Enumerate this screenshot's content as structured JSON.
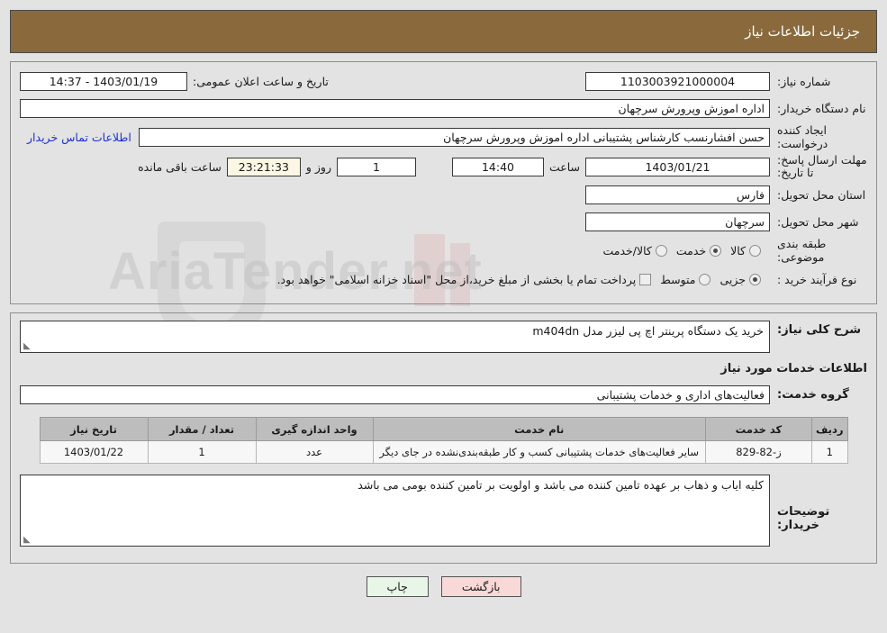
{
  "header": {
    "title": "جزئیات اطلاعات نیاز"
  },
  "form": {
    "need_number_label": "شماره نیاز:",
    "need_number": "1103003921000004",
    "announce_label": "تاریخ و ساعت اعلان عمومی:",
    "announce_value": "1403/01/19 - 14:37",
    "buyer_org_label": "نام دستگاه خریدار:",
    "buyer_org": "اداره اموزش وپرورش سرچهان",
    "creator_label": "ایجاد کننده درخواست:",
    "creator": "حسن افشارنسب کارشناس پشتیبانی اداره اموزش وپرورش سرچهان",
    "contact_link": "اطلاعات تماس خریدار",
    "deadline_label": "مهلت ارسال پاسخ: تا تاریخ:",
    "deadline_date": "1403/01/21",
    "hour_label": "ساعت",
    "deadline_time": "14:40",
    "days_remaining": "1",
    "days_label": "روز و",
    "countdown": "23:21:33",
    "remaining_label": "ساعت باقی مانده",
    "province_label": "استان محل تحویل:",
    "province": "فارس",
    "city_label": "شهر محل تحویل:",
    "city": "سرچهان",
    "category_label": "طبقه بندی موضوعی:",
    "category_options": [
      "کالا",
      "خدمت",
      "کالا/خدمت"
    ],
    "category_selected": "خدمت",
    "process_label": "نوع فرآیند خرید :",
    "process_options": [
      "جزیی",
      "متوسط"
    ],
    "process_selected": "جزیی",
    "treasury_note": "پرداخت تمام یا بخشی از مبلغ خرید،از محل \"اسناد خزانه اسلامی\" خواهد بود."
  },
  "description": {
    "summary_label": "شرح کلی نیاز:",
    "summary_value": "خرید یک دستگاه پرینتر اچ پی لیزر مدل m404dn",
    "services_heading": "اطلاعات خدمات مورد نیاز",
    "service_group_label": "گروه خدمت:",
    "service_group_value": "فعالیت‌های اداری و خدمات پشتیبانی"
  },
  "table": {
    "columns": [
      "ردیف",
      "کد خدمت",
      "نام خدمت",
      "واحد اندازه گیری",
      "تعداد / مقدار",
      "تاریخ نیاز"
    ],
    "rows": [
      {
        "index": "1",
        "code": "ز-82-829",
        "name": "سایر فعالیت‌های خدمات پشتیبانی کسب و کار طبقه‌بندی‌نشده در جای دیگر",
        "unit": "عدد",
        "qty": "1",
        "date": "1403/01/22"
      }
    ]
  },
  "buyer_notes": {
    "label": "توضیحات خریدار:",
    "value": "کلیه ایاب و ذهاب بر عهده تامین کننده می باشد و اولویت بر تامین کننده بومی می باشد"
  },
  "footer": {
    "print_label": "چاپ",
    "back_label": "بازگشت"
  },
  "watermark": {
    "text": "AriaTender.net"
  }
}
